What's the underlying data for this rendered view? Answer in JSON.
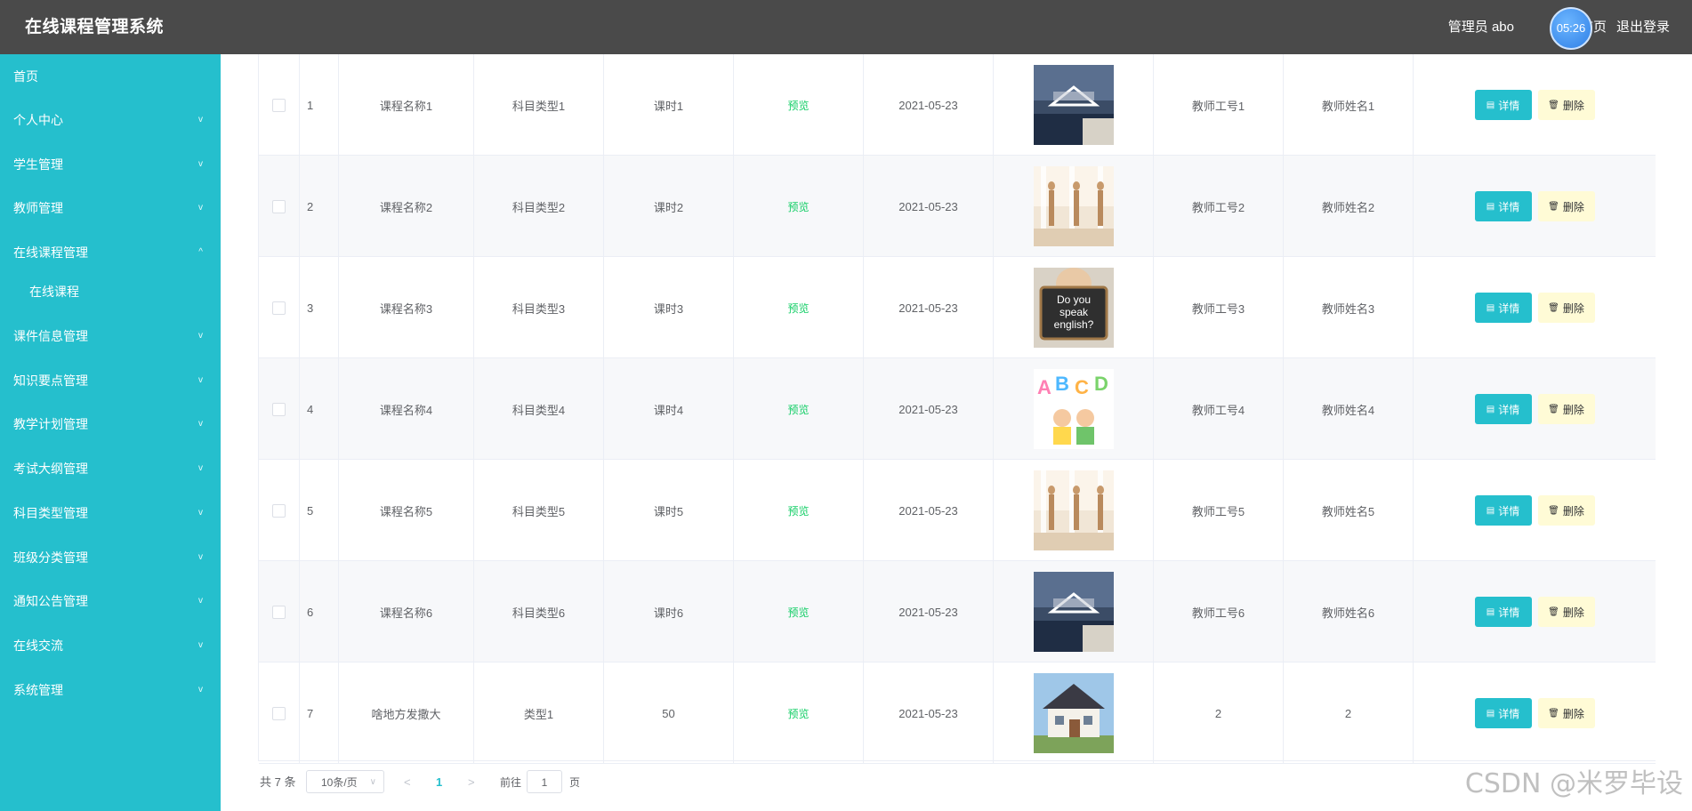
{
  "header": {
    "title": "在线课程管理系统",
    "user": "管理员 abo",
    "back": "退出首页",
    "logout": "退出登录",
    "clock": "05:26"
  },
  "sidebar": {
    "items": [
      {
        "label": "首页",
        "chevron": ""
      },
      {
        "label": "个人中心",
        "chevron": "down"
      },
      {
        "label": "学生管理",
        "chevron": "down"
      },
      {
        "label": "教师管理",
        "chevron": "down"
      },
      {
        "label": "在线课程管理",
        "chevron": "up"
      },
      {
        "label": "在线课程",
        "chevron": "",
        "sub": true
      },
      {
        "label": "课件信息管理",
        "chevron": "down"
      },
      {
        "label": "知识要点管理",
        "chevron": "down"
      },
      {
        "label": "教学计划管理",
        "chevron": "down"
      },
      {
        "label": "考试大纲管理",
        "chevron": "down"
      },
      {
        "label": "科目类型管理",
        "chevron": "down"
      },
      {
        "label": "班级分类管理",
        "chevron": "down"
      },
      {
        "label": "通知公告管理",
        "chevron": "down"
      },
      {
        "label": "在线交流",
        "chevron": "down"
      },
      {
        "label": "系统管理",
        "chevron": "down"
      }
    ]
  },
  "table": {
    "preview_label": "预览",
    "detail_label": "详情",
    "delete_label": "删除",
    "rows": [
      {
        "idx": "1",
        "name": "课程名称1",
        "subject": "科目类型1",
        "hours": "课时1",
        "date": "2021-05-23",
        "teacher_no": "教师工号1",
        "teacher_name": "教师姓名1",
        "image": "classroom-photo"
      },
      {
        "idx": "2",
        "name": "课程名称2",
        "subject": "科目类型2",
        "hours": "课时2",
        "date": "2021-05-23",
        "teacher_no": "教师工号2",
        "teacher_name": "教师姓名2",
        "image": "dance-photo"
      },
      {
        "idx": "3",
        "name": "课程名称3",
        "subject": "科目类型3",
        "hours": "课时3",
        "date": "2021-05-23",
        "teacher_no": "教师工号3",
        "teacher_name": "教师姓名3",
        "image": "english-chalkboard-photo"
      },
      {
        "idx": "4",
        "name": "课程名称4",
        "subject": "科目类型4",
        "hours": "课时4",
        "date": "2021-05-23",
        "teacher_no": "教师工号4",
        "teacher_name": "教师姓名4",
        "image": "abcd-kids-illustration"
      },
      {
        "idx": "5",
        "name": "课程名称5",
        "subject": "科目类型5",
        "hours": "课时5",
        "date": "2021-05-23",
        "teacher_no": "教师工号5",
        "teacher_name": "教师姓名5",
        "image": "dance-photo"
      },
      {
        "idx": "6",
        "name": "课程名称6",
        "subject": "科目类型6",
        "hours": "课时6",
        "date": "2021-05-23",
        "teacher_no": "教师工号6",
        "teacher_name": "教师姓名6",
        "image": "classroom-photo"
      },
      {
        "idx": "7",
        "name": "啥地方发撒大",
        "subject": "类型1",
        "hours": "50",
        "date": "2021-05-23",
        "teacher_no": "2",
        "teacher_name": "2",
        "image": "house-photo"
      }
    ]
  },
  "pager": {
    "total": "共 7 条",
    "page_size": "10条/页",
    "current_page": "1",
    "goto_label": "前往",
    "goto_value": "1",
    "goto_suffix": "页"
  },
  "watermark": "CSDN @米罗毕设",
  "colors": {
    "sidebar": "#25bfcd",
    "header": "#4a4a4a",
    "accent": "#25bfcd",
    "preview_text": "#13ce66",
    "delete_bg": "#fffbd6"
  }
}
